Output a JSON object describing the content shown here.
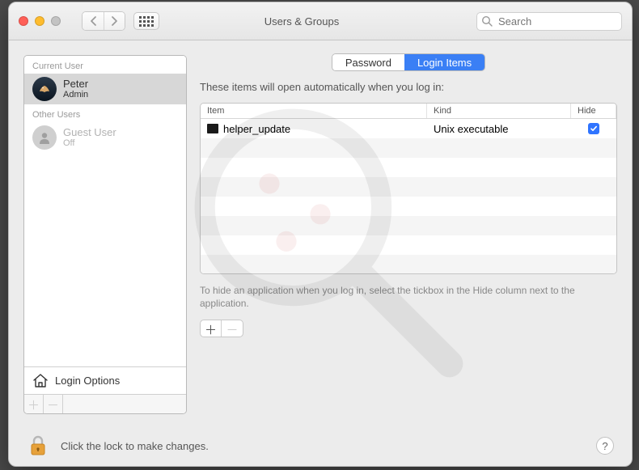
{
  "window": {
    "title": "Users & Groups",
    "search_placeholder": "Search"
  },
  "sidebar": {
    "sections": [
      {
        "label": "Current User",
        "users": [
          {
            "name": "Peter",
            "role": "Admin",
            "selected": true,
            "avatar": "eagle"
          }
        ]
      },
      {
        "label": "Other Users",
        "users": [
          {
            "name": "Guest User",
            "role": "Off",
            "selected": false,
            "avatar": "silhouette"
          }
        ]
      }
    ],
    "login_options_label": "Login Options"
  },
  "tabs": {
    "password": "Password",
    "login_items": "Login Items",
    "active": "login_items"
  },
  "main": {
    "heading": "These items will open automatically when you log in:",
    "columns": {
      "item": "Item",
      "kind": "Kind",
      "hide": "Hide"
    },
    "rows": [
      {
        "name": "helper_update",
        "kind": "Unix executable",
        "hide": true,
        "icon": "terminal"
      }
    ],
    "hint": "To hide an application when you log in, select the tickbox in the Hide column next to the application."
  },
  "footer": {
    "lock_text": "Click the lock to make changes.",
    "help_label": "?"
  }
}
